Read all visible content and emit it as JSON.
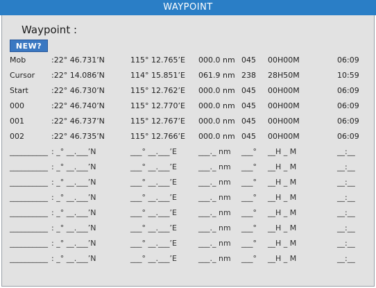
{
  "window": {
    "title": "WAYPOINT"
  },
  "header": {
    "waypoint_label": "Waypoint :",
    "new_button": "NEW?"
  },
  "waypoints": [
    {
      "name": "Mob",
      "lat": ":22° 46.731’N",
      "lon": "115° 12.765’E",
      "dist": "000.0 nm",
      "brg": "045",
      "ttg": "00H00M",
      "eta": "06:09"
    },
    {
      "name": "Cursor",
      "lat": ":22° 14.086’N",
      "lon": "114° 15.851’E",
      "dist": "061.9 nm",
      "brg": "238",
      "ttg": "28H50M",
      "eta": "10:59"
    },
    {
      "name": "Start",
      "lat": ":22° 46.730’N",
      "lon": "115° 12.762’E",
      "dist": "000.0 nm",
      "brg": "045",
      "ttg": "00H00M",
      "eta": "06:09"
    },
    {
      "name": "000",
      "lat": ":22° 46.740’N",
      "lon": "115° 12.770’E",
      "dist": "000.0 nm",
      "brg": "045",
      "ttg": "00H00M",
      "eta": "06:09"
    },
    {
      "name": "001",
      "lat": ":22° 46.737’N",
      "lon": "115° 12.767’E",
      "dist": "000.0 nm",
      "brg": "045",
      "ttg": "00H00M",
      "eta": "06:09"
    },
    {
      "name": "002",
      "lat": ":22° 46.735’N",
      "lon": "115° 12.766’E",
      "dist": "000.0 nm",
      "brg": "045",
      "ttg": "00H00M",
      "eta": "06:09"
    }
  ],
  "empty_row": {
    "name": "__________",
    "lat": ": _° __.___’N",
    "lon": "___° __.___’E",
    "dist": "___._ nm",
    "brg": "___°",
    "ttg": "__H _ M",
    "eta": "__:__"
  },
  "empty_rows": 8,
  "colors": {
    "title_bar": "#2a7ec6",
    "panel": "#e2e2e2",
    "new_button": "#3a78c2"
  }
}
